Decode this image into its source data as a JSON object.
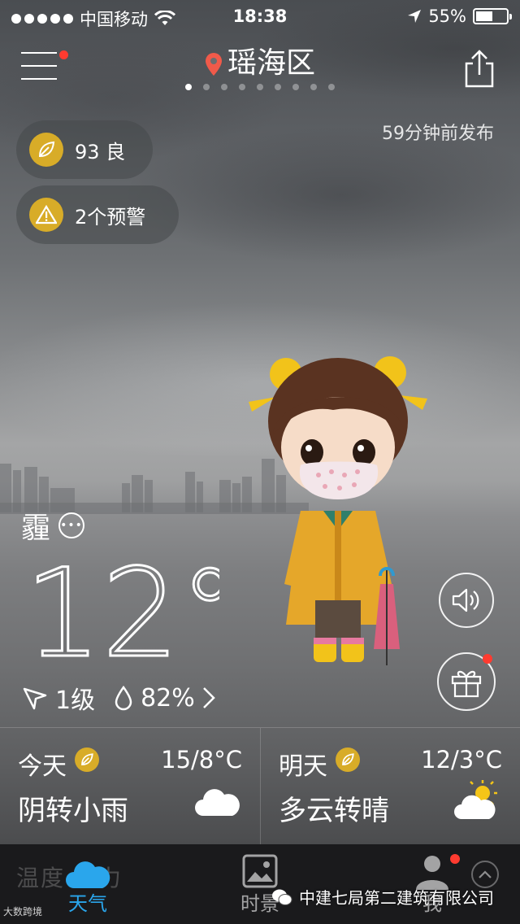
{
  "status_bar": {
    "carrier": "中国移动",
    "time": "18:38",
    "battery": "55%",
    "battery_level": 0.55
  },
  "header": {
    "city": "瑶海区",
    "page_count": 9,
    "active_page": 0,
    "publish_time": "59分钟前发布"
  },
  "badges": {
    "aqi": "93 良",
    "warnings": "2个预警"
  },
  "current": {
    "condition": "霾",
    "temperature": "12°",
    "wind": "1级",
    "humidity": "82%"
  },
  "forecast": [
    {
      "day": "今天",
      "range": "15/8°C",
      "description": "阴转小雨",
      "icon": "cloud-icon"
    },
    {
      "day": "明天",
      "range": "12/3°C",
      "description": "多云转晴",
      "icon": "sun-cloud-icon"
    }
  ],
  "tabs": {
    "weather": "天气",
    "scene": "时景",
    "me": "我"
  },
  "overlay": {
    "ghost_left": "温度",
    "ghost_right": "风力",
    "watermark": "中建七局第二建筑有限公司",
    "corner_mark": "大数跨境"
  },
  "colors": {
    "accent": "#2aa6ec",
    "badge": "#d8ac28",
    "alert_dot": "#ff3b30"
  }
}
